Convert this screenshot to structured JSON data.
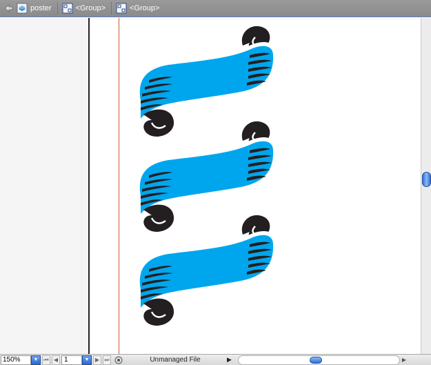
{
  "breadcrumb": {
    "items": [
      {
        "label": "poster",
        "icon": "layer-icon"
      },
      {
        "label": "<Group>",
        "icon": "group-icon"
      },
      {
        "label": "<Group>",
        "icon": "group-icon"
      }
    ]
  },
  "artwork": {
    "banner_count": 3,
    "banner_fill": "#00a6ed",
    "banner_stroke": "#ffffff",
    "scroll_fill": "#231f20"
  },
  "status": {
    "zoom": "150%",
    "page": "1",
    "file_status": "Unmanaged File"
  },
  "colors": {
    "accent": "#2c68cf",
    "bleed_guide": "#c85a2e"
  }
}
